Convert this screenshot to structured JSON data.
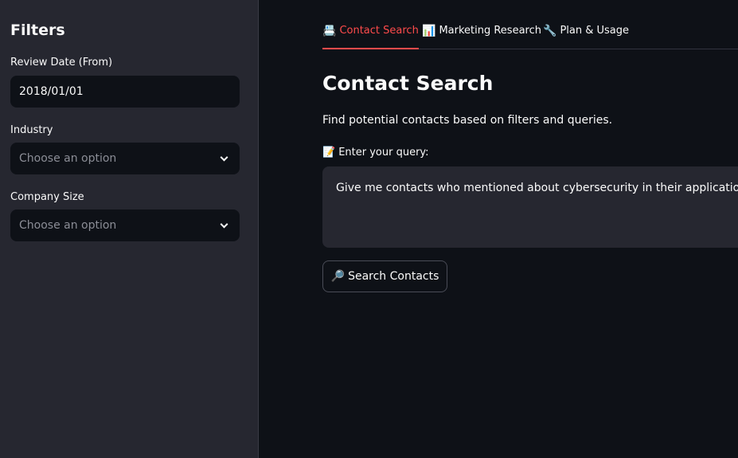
{
  "sidebar": {
    "title": "Filters",
    "review_date": {
      "label": "Review Date (From)",
      "value": "2018/01/01"
    },
    "industry": {
      "label": "Industry",
      "placeholder": "Choose an option"
    },
    "company_size": {
      "label": "Company Size",
      "placeholder": "Choose an option"
    }
  },
  "tabs": [
    {
      "icon": "📇",
      "icon_name": "card-index-icon",
      "label": "Contact Search",
      "active": true
    },
    {
      "icon": "📊",
      "icon_name": "bar-chart-icon",
      "label": "Marketing Research",
      "active": false
    },
    {
      "icon": "🔧",
      "icon_name": "wrench-icon",
      "label": "Plan & Usage",
      "active": false
    }
  ],
  "main": {
    "title": "Contact Search",
    "description": "Find potential contacts based on filters and queries.",
    "query_label_icon": "📝",
    "query_label": "Enter your query:",
    "query_value": "Give me contacts who mentioned about cybersecurity in their applications",
    "search_button_icon": "🔎",
    "search_button_label": "Search Contacts"
  },
  "colors": {
    "accent": "#ff4b4b",
    "background": "#0e1117",
    "sidebar": "#262730"
  }
}
